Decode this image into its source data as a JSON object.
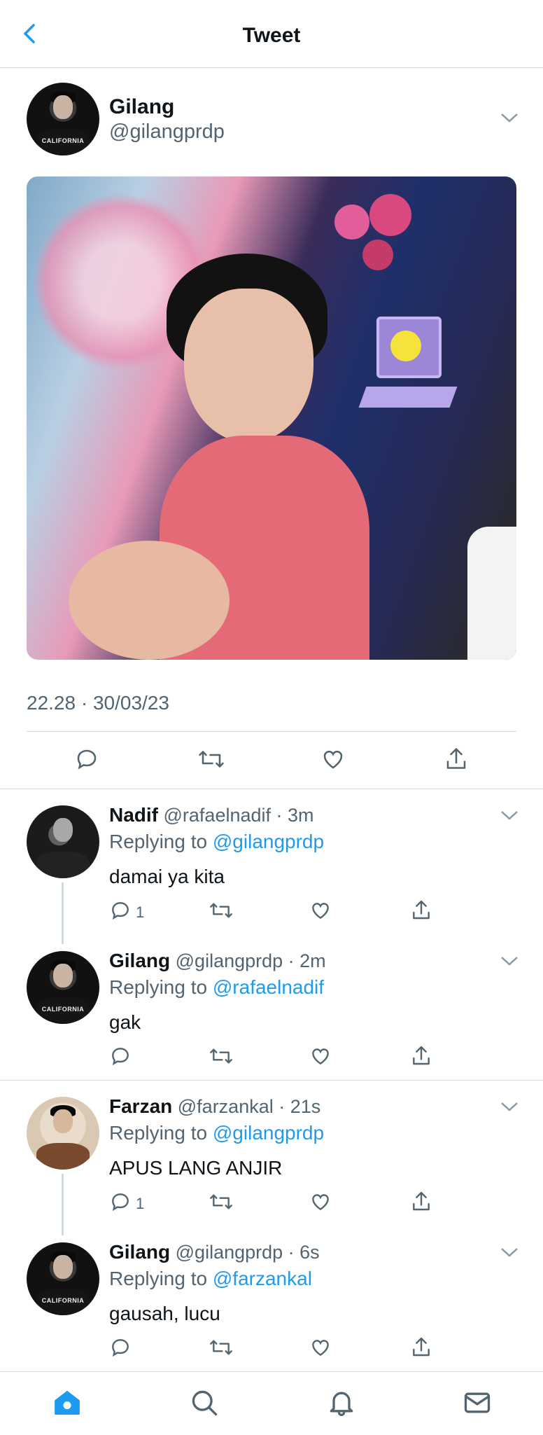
{
  "header": {
    "title": "Tweet"
  },
  "main_tweet": {
    "name": "Gilang",
    "handle": "@gilangprdp",
    "avatar_text": "CALIFORNIA",
    "timestamp": "22.28 · 30/03/23"
  },
  "replies": [
    {
      "name": "Nadif",
      "handle": "@rafaelnadif",
      "time": "· 3m",
      "replying_prefix": "Replying to",
      "replying_to": "@gilangprdp",
      "text": "damai ya kita",
      "reply_count": "1"
    },
    {
      "name": "Gilang",
      "handle": "@gilangprdp",
      "time": "· 2m",
      "replying_prefix": "Replying to",
      "replying_to": "@rafaelnadif",
      "text": "gak",
      "reply_count": "",
      "avatar_text": "CALIFORNIA"
    },
    {
      "name": "Farzan",
      "handle": "@farzankal",
      "time": "· 21s",
      "replying_prefix": "Replying to",
      "replying_to": "@gilangprdp",
      "text": "APUS LANG ANJIR",
      "reply_count": "1"
    },
    {
      "name": "Gilang",
      "handle": "@gilangprdp",
      "time": "· 6s",
      "replying_prefix": "Replying to",
      "replying_to": "@farzankal",
      "text": "gausah, lucu",
      "reply_count": "",
      "avatar_text": "CALIFORNIA"
    }
  ],
  "tabbar": {
    "items": [
      "home-icon",
      "search-icon",
      "notifications-icon",
      "messages-icon"
    ],
    "active": "home-icon"
  },
  "colors": {
    "accent": "#1d9bf0",
    "secondary_text": "#536471",
    "divider": "#d6d9db"
  }
}
